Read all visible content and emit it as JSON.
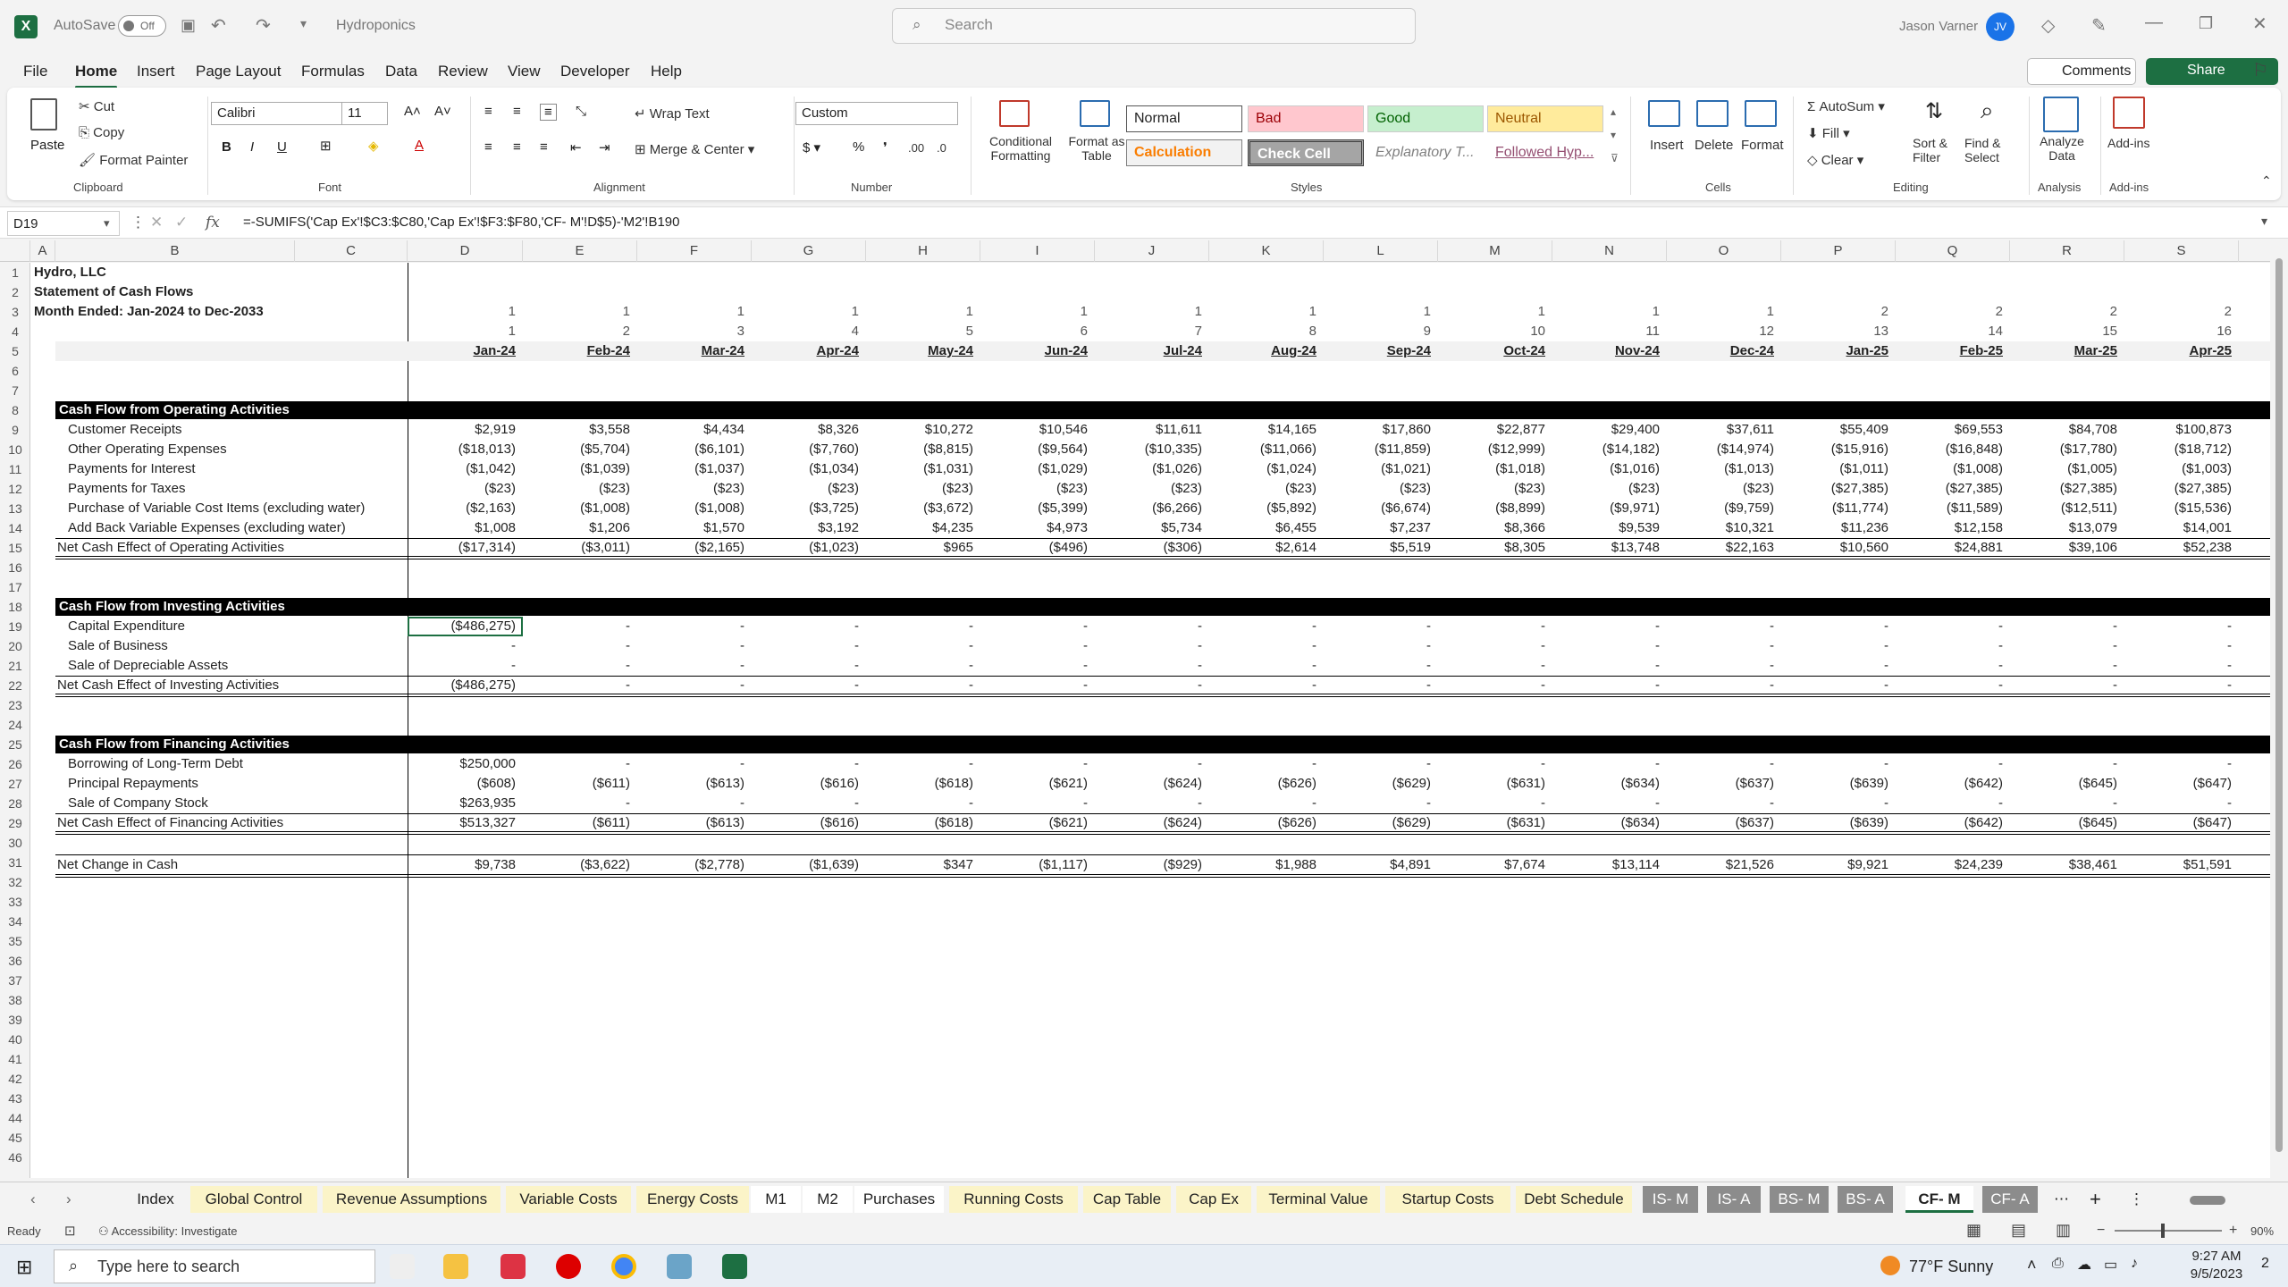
{
  "window": {
    "autosave_label": "AutoSave",
    "autosave_state": "Off",
    "doc_title": "Hydroponics",
    "search_placeholder": "Search",
    "user_name": "Jason Varner",
    "user_initials": "JV"
  },
  "menu": [
    "File",
    "Home",
    "Insert",
    "Page Layout",
    "Formulas",
    "Data",
    "Review",
    "View",
    "Developer",
    "Help"
  ],
  "menu_active": "Home",
  "buttons": {
    "comments": "Comments",
    "share": "Share"
  },
  "ribbon": {
    "clipboard": {
      "paste": "Paste",
      "cut": "Cut",
      "copy": "Copy",
      "format_painter": "Format Painter",
      "group": "Clipboard"
    },
    "font": {
      "name": "Calibri",
      "size": "11",
      "group": "Font"
    },
    "alignment": {
      "wrap": "Wrap Text",
      "merge": "Merge & Center",
      "group": "Alignment"
    },
    "number": {
      "format": "Custom",
      "group": "Number"
    },
    "styles": {
      "cond": "Conditional Formatting",
      "table": "Format as Table",
      "normal": "Normal",
      "bad": "Bad",
      "good": "Good",
      "neutral": "Neutral",
      "calc": "Calculation",
      "check": "Check Cell",
      "explan": "Explanatory T...",
      "followed": "Followed Hyp...",
      "group": "Styles"
    },
    "cells": {
      "insert": "Insert",
      "delete": "Delete",
      "format": "Format",
      "group": "Cells"
    },
    "editing": {
      "autosum": "AutoSum",
      "fill": "Fill",
      "clear": "Clear",
      "sort": "Sort & Filter",
      "find": "Find & Select",
      "group": "Editing"
    },
    "analysis": {
      "analyze": "Analyze Data",
      "group": "Analysis"
    },
    "addins": {
      "label": "Add-ins",
      "group": "Add-ins"
    }
  },
  "formula_bar": {
    "cell_ref": "D19",
    "formula": "=-SUMIFS('Cap Ex'!$C3:$C80,'Cap Ex'!$F3:$F80,'CF- M'!D$5)-'M2'!B190"
  },
  "columns": [
    "A",
    "B",
    "C",
    "D",
    "E",
    "F",
    "G",
    "H",
    "I",
    "J",
    "K",
    "L",
    "M",
    "N",
    "O",
    "P",
    "Q",
    "R",
    "S"
  ],
  "sheet": {
    "company": "Hydro, LLC",
    "statement": "Statement of Cash Flows",
    "period": "Month Ended: Jan-2024 to Dec-2033",
    "row3": [
      "1",
      "1",
      "1",
      "1",
      "1",
      "1",
      "1",
      "1",
      "1",
      "1",
      "1",
      "1",
      "2",
      "2",
      "2",
      "2"
    ],
    "row4": [
      "1",
      "2",
      "3",
      "4",
      "5",
      "6",
      "7",
      "8",
      "9",
      "10",
      "11",
      "12",
      "13",
      "14",
      "15",
      "16"
    ],
    "months": [
      "Jan-24",
      "Feb-24",
      "Mar-24",
      "Apr-24",
      "May-24",
      "Jun-24",
      "Jul-24",
      "Aug-24",
      "Sep-24",
      "Oct-24",
      "Nov-24",
      "Dec-24",
      "Jan-25",
      "Feb-25",
      "Mar-25",
      "Apr-25"
    ],
    "operating_header": "Cash Flow from Operating Activities",
    "operating": [
      {
        "label": "Customer Receipts",
        "values": [
          "$2,919",
          "$3,558",
          "$4,434",
          "$8,326",
          "$10,272",
          "$10,546",
          "$11,611",
          "$14,165",
          "$17,860",
          "$22,877",
          "$29,400",
          "$37,611",
          "$55,409",
          "$69,553",
          "$84,708",
          "$100,873"
        ]
      },
      {
        "label": "Other Operating Expenses",
        "values": [
          "($18,013)",
          "($5,704)",
          "($6,101)",
          "($7,760)",
          "($8,815)",
          "($9,564)",
          "($10,335)",
          "($11,066)",
          "($11,859)",
          "($12,999)",
          "($14,182)",
          "($14,974)",
          "($15,916)",
          "($16,848)",
          "($17,780)",
          "($18,712)"
        ]
      },
      {
        "label": "Payments for Interest",
        "values": [
          "($1,042)",
          "($1,039)",
          "($1,037)",
          "($1,034)",
          "($1,031)",
          "($1,029)",
          "($1,026)",
          "($1,024)",
          "($1,021)",
          "($1,018)",
          "($1,016)",
          "($1,013)",
          "($1,011)",
          "($1,008)",
          "($1,005)",
          "($1,003)"
        ]
      },
      {
        "label": "Payments for Taxes",
        "values": [
          "($23)",
          "($23)",
          "($23)",
          "($23)",
          "($23)",
          "($23)",
          "($23)",
          "($23)",
          "($23)",
          "($23)",
          "($23)",
          "($23)",
          "($27,385)",
          "($27,385)",
          "($27,385)",
          "($27,385)"
        ]
      },
      {
        "label": "Purchase of Variable Cost Items (excluding water)",
        "values": [
          "($2,163)",
          "($1,008)",
          "($1,008)",
          "($3,725)",
          "($3,672)",
          "($5,399)",
          "($6,266)",
          "($5,892)",
          "($6,674)",
          "($8,899)",
          "($9,971)",
          "($9,759)",
          "($11,774)",
          "($11,589)",
          "($12,511)",
          "($15,536)"
        ]
      },
      {
        "label": "Add Back Variable Expenses (excluding water)",
        "values": [
          "$1,008",
          "$1,206",
          "$1,570",
          "$3,192",
          "$4,235",
          "$4,973",
          "$5,734",
          "$6,455",
          "$7,237",
          "$8,366",
          "$9,539",
          "$10,321",
          "$11,236",
          "$12,158",
          "$13,079",
          "$14,001"
        ]
      }
    ],
    "operating_total": {
      "label": "Net Cash Effect of Operating Activities",
      "values": [
        "($17,314)",
        "($3,011)",
        "($2,165)",
        "($1,023)",
        "$965",
        "($496)",
        "($306)",
        "$2,614",
        "$5,519",
        "$8,305",
        "$13,748",
        "$22,163",
        "$10,560",
        "$24,881",
        "$39,106",
        "$52,238"
      ]
    },
    "investing_header": "Cash Flow from Investing Activities",
    "investing": [
      {
        "label": "Capital Expenditure",
        "values": [
          "($486,275)",
          "-",
          "-",
          "-",
          "-",
          "-",
          "-",
          "-",
          "-",
          "-",
          "-",
          "-",
          "-",
          "-",
          "-",
          "-"
        ]
      },
      {
        "label": "Sale of Business",
        "values": [
          "-",
          "-",
          "-",
          "-",
          "-",
          "-",
          "-",
          "-",
          "-",
          "-",
          "-",
          "-",
          "-",
          "-",
          "-",
          "-"
        ]
      },
      {
        "label": "Sale of Depreciable Assets",
        "values": [
          "-",
          "-",
          "-",
          "-",
          "-",
          "-",
          "-",
          "-",
          "-",
          "-",
          "-",
          "-",
          "-",
          "-",
          "-",
          "-"
        ]
      }
    ],
    "investing_total": {
      "label": "Net Cash Effect of Investing Activities",
      "values": [
        "($486,275)",
        "-",
        "-",
        "-",
        "-",
        "-",
        "-",
        "-",
        "-",
        "-",
        "-",
        "-",
        "-",
        "-",
        "-",
        "-"
      ]
    },
    "financing_header": "Cash Flow from Financing Activities",
    "financing": [
      {
        "label": "Borrowing of Long-Term Debt",
        "values": [
          "$250,000",
          "-",
          "-",
          "-",
          "-",
          "-",
          "-",
          "-",
          "-",
          "-",
          "-",
          "-",
          "-",
          "-",
          "-",
          "-"
        ]
      },
      {
        "label": "Principal Repayments",
        "values": [
          "($608)",
          "($611)",
          "($613)",
          "($616)",
          "($618)",
          "($621)",
          "($624)",
          "($626)",
          "($629)",
          "($631)",
          "($634)",
          "($637)",
          "($639)",
          "($642)",
          "($645)",
          "($647)"
        ]
      },
      {
        "label": "Sale of Company Stock",
        "values": [
          "$263,935",
          "-",
          "-",
          "-",
          "-",
          "-",
          "-",
          "-",
          "-",
          "-",
          "-",
          "-",
          "-",
          "-",
          "-",
          "-"
        ]
      }
    ],
    "financing_total": {
      "label": "Net Cash Effect of Financing Activities",
      "values": [
        "$513,327",
        "($611)",
        "($613)",
        "($616)",
        "($618)",
        "($621)",
        "($624)",
        "($626)",
        "($629)",
        "($631)",
        "($634)",
        "($637)",
        "($639)",
        "($642)",
        "($645)",
        "($647)"
      ]
    },
    "net_change": {
      "label": "Net Change in Cash",
      "values": [
        "$9,738",
        "($3,622)",
        "($2,778)",
        "($1,639)",
        "$347",
        "($1,117)",
        "($929)",
        "$1,988",
        "$4,891",
        "$7,674",
        "$13,114",
        "$21,526",
        "$9,921",
        "$24,239",
        "$38,461",
        "$51,591"
      ]
    }
  },
  "tabs": [
    {
      "name": "Index",
      "color": "#f3f3f3",
      "fg": "#222"
    },
    {
      "name": "Global Control",
      "color": "#fbf4c8",
      "fg": "#222"
    },
    {
      "name": "Revenue Assumptions",
      "color": "#fbf4c8",
      "fg": "#222"
    },
    {
      "name": "Variable Costs",
      "color": "#fbf4c8",
      "fg": "#222"
    },
    {
      "name": "Energy Costs",
      "color": "#fbf4c8",
      "fg": "#222"
    },
    {
      "name": "M1",
      "color": "#ffffff",
      "fg": "#222"
    },
    {
      "name": "M2",
      "color": "#ffffff",
      "fg": "#222"
    },
    {
      "name": "Purchases",
      "color": "#ffffff",
      "fg": "#222"
    },
    {
      "name": "Running Costs",
      "color": "#fbf4c8",
      "fg": "#222"
    },
    {
      "name": "Cap Table",
      "color": "#fbf4c8",
      "fg": "#222"
    },
    {
      "name": "Cap Ex",
      "color": "#fbf4c8",
      "fg": "#222"
    },
    {
      "name": "Terminal Value",
      "color": "#fbf4c8",
      "fg": "#222"
    },
    {
      "name": "Startup Costs",
      "color": "#fbf4c8",
      "fg": "#222"
    },
    {
      "name": "Debt Schedule",
      "color": "#fbf4c8",
      "fg": "#222"
    },
    {
      "name": "IS- M",
      "color": "#8c8c8c",
      "fg": "#fff"
    },
    {
      "name": "IS- A",
      "color": "#8c8c8c",
      "fg": "#fff"
    },
    {
      "name": "BS- M",
      "color": "#8c8c8c",
      "fg": "#fff"
    },
    {
      "name": "BS- A",
      "color": "#8c8c8c",
      "fg": "#fff"
    },
    {
      "name": "CF- M",
      "color": "#ffffff",
      "fg": "#222"
    },
    {
      "name": "CF- A",
      "color": "#8c8c8c",
      "fg": "#fff"
    }
  ],
  "active_tab": "CF- M",
  "status": {
    "ready": "Ready",
    "accessibility": "Accessibility: Investigate",
    "zoom": "90%"
  },
  "taskbar": {
    "search": "Type here to search",
    "weather": "77°F  Sunny",
    "time": "9:27 AM",
    "date": "9/5/2023",
    "notif": "2"
  },
  "colors": {
    "excel_green": "#1d6f42",
    "header_black": "#000000"
  }
}
